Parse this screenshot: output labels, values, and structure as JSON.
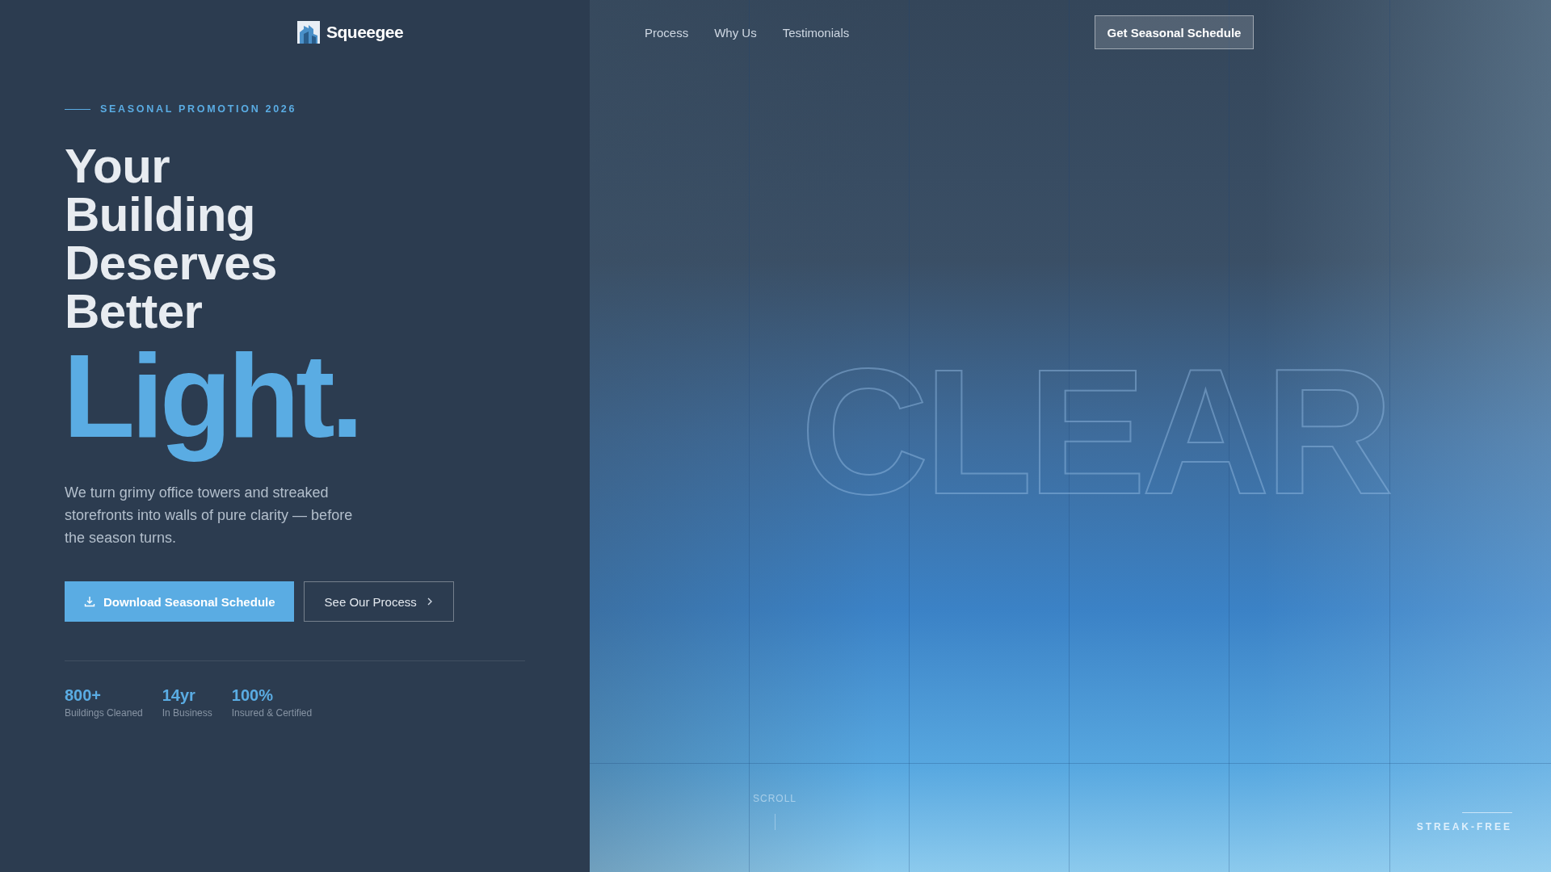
{
  "header": {
    "brand": "Squeegee",
    "nav": [
      {
        "label": "Process"
      },
      {
        "label": "Why Us"
      },
      {
        "label": "Testimonials"
      }
    ],
    "cta": "Get Seasonal Schedule"
  },
  "hero": {
    "eyebrow": "SEASONAL PROMOTION 2026",
    "headline": [
      "Your",
      "Building",
      "Deserves",
      "Better"
    ],
    "accent": "Light.",
    "description": "We turn grimy office towers and streaked storefronts into walls of pure clarity — before the season turns.",
    "buttons": [
      {
        "kind": "primary",
        "label": "Download Seasonal Schedule"
      },
      {
        "kind": "secondary",
        "label": "See Our Process"
      }
    ],
    "stats": [
      {
        "value": "800+",
        "label": "Buildings Cleaned"
      },
      {
        "value": "14yr",
        "label": "In Business"
      },
      {
        "value": "100%",
        "label": "Insured & Certified"
      }
    ]
  },
  "facade": {
    "watermark": "CLEAR",
    "scroll_label": "SCROLL",
    "tag": "STREAK-FREE"
  }
}
